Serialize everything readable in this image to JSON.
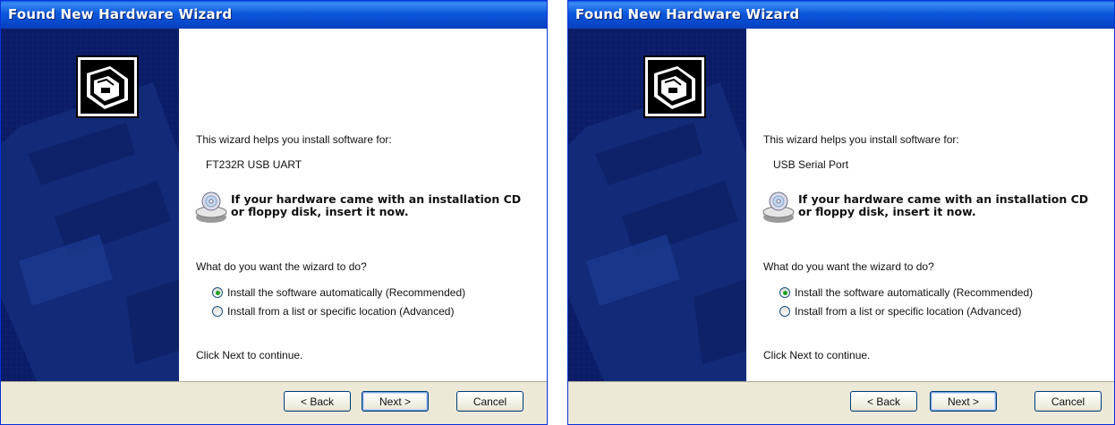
{
  "windows": [
    {
      "title": "Found New Hardware Wizard",
      "intro": "This wizard helps you install software for:",
      "device": "FT232R USB UART",
      "cd_prompt_line1": "If your hardware came with an installation CD",
      "cd_prompt_line2": "or floppy disk, insert it now.",
      "question": "What do you want the wizard to do?",
      "options": [
        {
          "label": "Install the software automatically (Recommended)",
          "selected": true
        },
        {
          "label": "Install from a list or specific location (Advanced)",
          "selected": false
        }
      ],
      "continue_text": "Click Next to continue.",
      "buttons": {
        "back": "< Back",
        "next": "Next >",
        "cancel": "Cancel"
      }
    },
    {
      "title": "Found New Hardware Wizard",
      "intro": "This wizard helps you install software for:",
      "device": "USB Serial Port",
      "cd_prompt_line1": "If your hardware came with an installation CD",
      "cd_prompt_line2": "or floppy disk, insert it now.",
      "question": "What do you want the wizard to do?",
      "options": [
        {
          "label": "Install the software automatically (Recommended)",
          "selected": true
        },
        {
          "label": "Install from a list or specific location (Advanced)",
          "selected": false
        }
      ],
      "continue_text": "Click Next to continue.",
      "buttons": {
        "back": "< Back",
        "next": "Next >",
        "cancel": "Cancel"
      }
    }
  ]
}
